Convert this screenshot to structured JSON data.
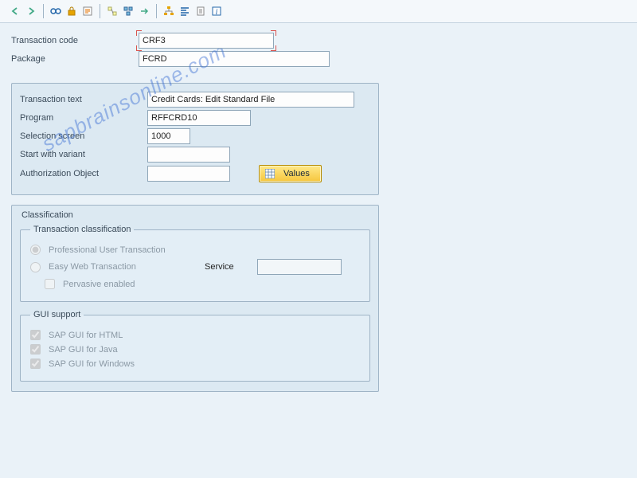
{
  "watermark": "sapbrainsonline.com",
  "toolbar": {
    "icons": [
      "back",
      "forward",
      "glasses",
      "lock",
      "edit",
      "where-used",
      "attach",
      "hierarchy",
      "align",
      "column",
      "info"
    ]
  },
  "top": {
    "tcode_label": "Transaction code",
    "tcode_value": "CRF3",
    "package_label": "Package",
    "package_value": "FCRD"
  },
  "details": {
    "text_label": "Transaction text",
    "text_value": "Credit Cards: Edit Standard File",
    "program_label": "Program",
    "program_value": "RFFCRD10",
    "selscreen_label": "Selection screen",
    "selscreen_value": "1000",
    "variant_label": "Start with variant",
    "variant_value": "",
    "authobj_label": "Authorization Object",
    "authobj_value": "",
    "values_btn": "Values"
  },
  "classification": {
    "title": "Classification",
    "group_title": "Transaction classification",
    "opt_pro": "Professional User Transaction",
    "opt_easy": "Easy Web Transaction",
    "service_label": "Service",
    "service_value": "",
    "pervasive": "Pervasive enabled"
  },
  "gui": {
    "group_title": "GUI support",
    "html": "SAP GUI for HTML",
    "java": "SAP GUI for Java",
    "win": "SAP GUI for Windows"
  }
}
